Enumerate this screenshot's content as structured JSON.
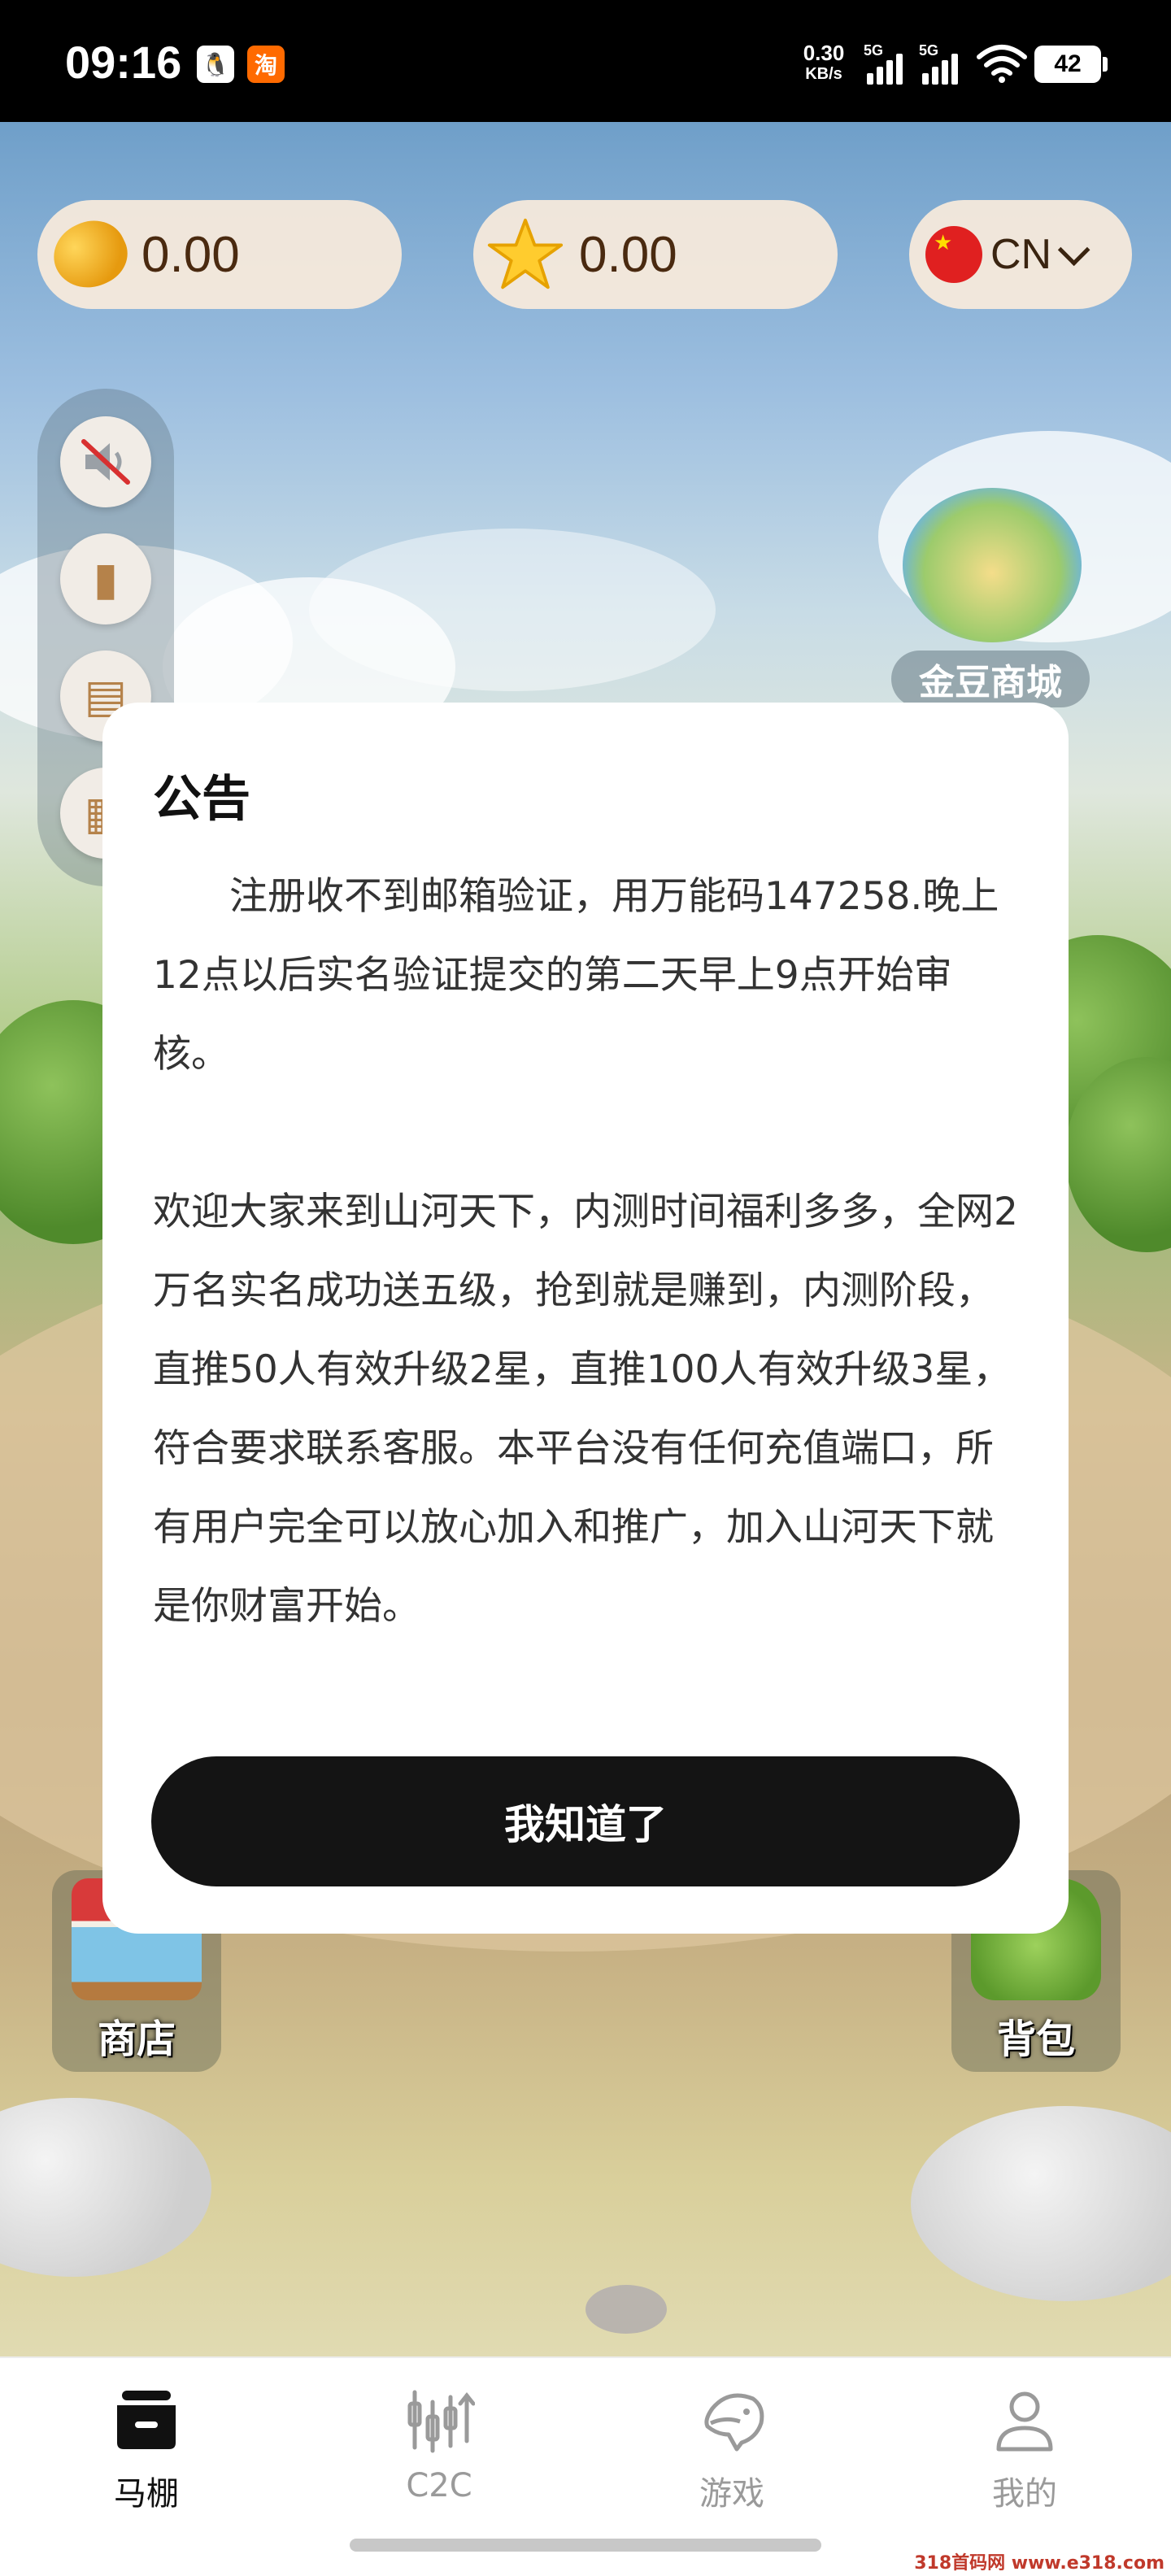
{
  "status_bar": {
    "time": "09:16",
    "apps": [
      {
        "icon": "qq-icon",
        "glyph": "🐧"
      },
      {
        "icon": "taobao-icon",
        "glyph": "淘"
      }
    ],
    "net_speed_value": "0.30",
    "net_speed_unit": "KB/s",
    "signal_tags": [
      "5G",
      "5G"
    ],
    "battery": "42"
  },
  "currency": {
    "beans": "0.00",
    "stars": "0.00",
    "language": "CN"
  },
  "shop_island": {
    "label": "金豆商城"
  },
  "quick_buttons": {
    "store": "商店",
    "backpack": "背包"
  },
  "announcement": {
    "title": "公告",
    "paragraph1": "注册收不到邮箱验证，用万能码147258.晚上12点以后实名验证提交的第二天早上9点开始审核。",
    "paragraph2": "欢迎大家来到山河天下，内测时间福利多多，全网2万名实名成功送五级，抢到就是赚到，内测阶段，直推50人有效升级2星，直推100人有效升级3星，符合要求联系客服。本平台没有任何充值端口，所有用户完全可以放心加入和推广，加入山河天下就是你财富开始。",
    "confirm_label": "我知道了"
  },
  "bottom_nav": [
    {
      "label": "马棚",
      "icon": "stable-icon",
      "active": true
    },
    {
      "label": "C2C",
      "icon": "candlestick-icon",
      "active": false
    },
    {
      "label": "游戏",
      "icon": "horse-head-icon",
      "active": false
    },
    {
      "label": "我的",
      "icon": "profile-icon",
      "active": false
    }
  ],
  "watermark": "318首码网 www.e318.com",
  "colors": {
    "accent_dark": "#141414",
    "pill_bg": "#fff0de",
    "nav_inactive": "#9a9a9a"
  }
}
